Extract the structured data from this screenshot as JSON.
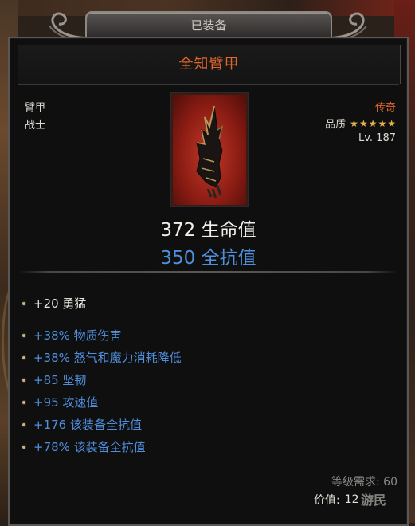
{
  "header": {
    "title": "已装备"
  },
  "item": {
    "name": "全知臂甲",
    "type": "臂甲",
    "class": "战士",
    "rarity": "传奇",
    "quality_label": "品质",
    "quality_stars": 5,
    "level": "Lv. 187",
    "icon": "gauntlet-icon"
  },
  "stats": {
    "life": "372 生命值",
    "resistance": "350 全抗值"
  },
  "affixes": {
    "primary": [
      {
        "text": "+20 勇猛",
        "color": "white"
      }
    ],
    "secondary": [
      {
        "text": "+38% 物质伤害",
        "color": "blue"
      },
      {
        "text": "+38% 怒气和魔力消耗降低",
        "color": "blue"
      },
      {
        "text": "+85 坚韧",
        "color": "blue"
      },
      {
        "text": "+95 攻速值",
        "color": "blue"
      },
      {
        "text": "+176 该装备全抗值",
        "color": "blue"
      },
      {
        "text": "+78% 该装备全抗值",
        "color": "blue"
      }
    ]
  },
  "footer": {
    "level_requirement": "等级需求: 60",
    "price_label": "价值:",
    "price_value": "12",
    "watermark": "游民"
  },
  "colors": {
    "legendary": "#e0662a",
    "magic_blue": "#4f8fdc",
    "star_gold": "#e3b24a"
  }
}
